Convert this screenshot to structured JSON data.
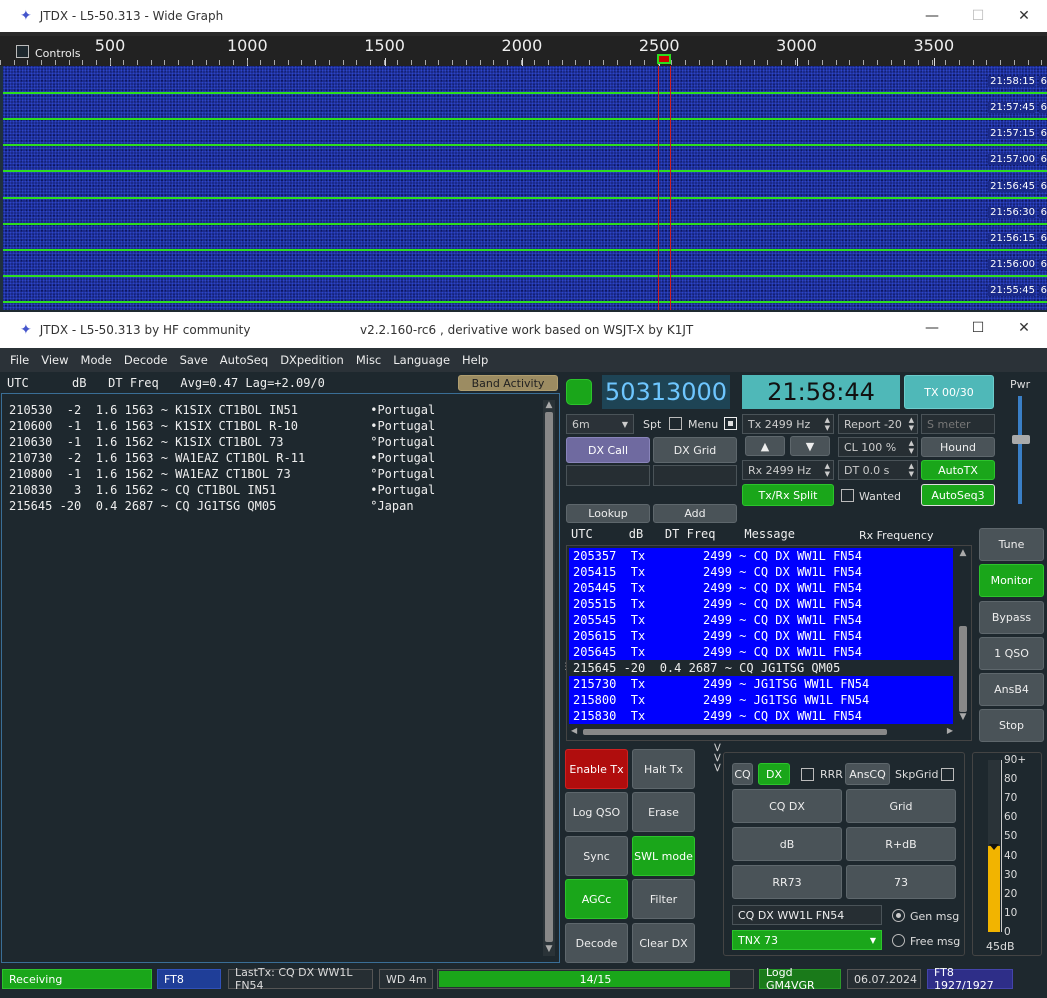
{
  "wide_graph": {
    "title": "JTDX - L5-50.313 - Wide Graph",
    "controls_label": "Controls",
    "scale_labels": [
      "500",
      "1000",
      "1500",
      "2000",
      "2500",
      "3000",
      "3500"
    ],
    "time_labels": [
      "21:58:15",
      "21:57:45",
      "21:57:15",
      "21:57:00",
      "21:56:45",
      "21:56:30",
      "21:56:15",
      "21:56:00",
      "21:55:45"
    ],
    "edge_labels": [
      "6",
      "6",
      "6",
      "6",
      "6",
      "6",
      "6",
      "6",
      "6"
    ]
  },
  "main": {
    "title": "JTDX - L5-50.313  by HF community",
    "subtitle": "v2.2.160-rc6 , derivative work based on WSJT-X by K1JT",
    "menu": [
      "File",
      "View",
      "Mode",
      "Decode",
      "Save",
      "AutoSeq",
      "DXpedition",
      "Misc",
      "Language",
      "Help"
    ],
    "band_header": "UTC      dB   DT Freq   Avg=0.47 Lag=+2.09/0",
    "band_activity_label": "Band Activity",
    "band_rows": [
      "210530  -2  1.6 1563 ~ K1SIX CT1BOL IN51          •Portugal",
      "210600  -1  1.6 1563 ~ K1SIX CT1BOL R-10          •Portugal",
      "210630  -1  1.6 1562 ~ K1SIX CT1BOL 73            °Portugal",
      "210730  -2  1.6 1563 ~ WA1EAZ CT1BOL R-11         •Portugal",
      "210800  -1  1.6 1562 ~ WA1EAZ CT1BOL 73           °Portugal",
      "210830   3  1.6 1562 ~ CQ CT1BOL IN51             •Portugal",
      "215645 -20  0.4 2687 ~ CQ JG1TSG QM05             °Japan"
    ],
    "frequency": "50313000",
    "clock": "21:58:44",
    "tx_counter": "TX 00/30",
    "pwr_label": "Pwr",
    "band": "6m",
    "spt_label": "Spt",
    "menu_label": "Menu",
    "tx_hz": "Tx  2499  Hz",
    "rx_hz": "Rx  2499  Hz",
    "report": "Report -20",
    "smeter": "S meter",
    "cl": "CL  100 %",
    "dt": "DT 0.0 s",
    "dx_call_label": "DX Call",
    "dx_grid_label": "DX Grid",
    "hound_label": "Hound",
    "autotx_label": "AutoTX",
    "autoseq_label": "AutoSeq3",
    "txrx_split_label": "Tx/Rx Split",
    "wanted_label": "Wanted",
    "lookup_label": "Lookup",
    "add_label": "Add",
    "rx_header": "UTC     dB   DT Freq    Message",
    "rx_freq_label": "Rx Frequency",
    "rx_rows": [
      {
        "t": "205357  Tx        2499 ~ CQ DX WW1L FN54",
        "tx": true
      },
      {
        "t": "205415  Tx        2499 ~ CQ DX WW1L FN54",
        "tx": true
      },
      {
        "t": "205445  Tx        2499 ~ CQ DX WW1L FN54",
        "tx": true
      },
      {
        "t": "205515  Tx        2499 ~ CQ DX WW1L FN54",
        "tx": true
      },
      {
        "t": "205545  Tx        2499 ~ CQ DX WW1L FN54",
        "tx": true
      },
      {
        "t": "205615  Tx        2499 ~ CQ DX WW1L FN54",
        "tx": true
      },
      {
        "t": "205645  Tx        2499 ~ CQ DX WW1L FN54",
        "tx": true
      },
      {
        "t": "215645 -20  0.4 2687 ~ CQ JG1TSG QM05",
        "tx": false
      },
      {
        "t": "215730  Tx        2499 ~ JG1TSG WW1L FN54",
        "tx": true
      },
      {
        "t": "215800  Tx        2499 ~ JG1TSG WW1L FN54",
        "tx": true
      },
      {
        "t": "215830  Tx        2499 ~ CQ DX WW1L FN54",
        "tx": true
      }
    ],
    "side_buttons": [
      "Tune",
      "Monitor",
      "Bypass",
      "1 QSO",
      "AnsB4",
      "Stop"
    ],
    "grid_buttons": [
      "Enable Tx",
      "Halt Tx",
      "Log QSO",
      "Erase",
      "Sync",
      "SWL mode",
      "AGCc",
      "Filter",
      "Decode",
      "Clear DX"
    ],
    "cq_label": "CQ",
    "dx_label": "DX",
    "rrr_label": "RRR",
    "anscq_label": "AnsCQ",
    "skpgrid_label": "SkpGrid",
    "msg_buttons": [
      "CQ DX",
      "Grid",
      "dB",
      "R+dB",
      "RR73",
      "73"
    ],
    "gen_msg_value": "CQ DX WW1L FN54",
    "free_msg_value": "TNX 73",
    "gen_msg_label": "Gen msg",
    "free_msg_label": "Free msg",
    "meter_labels": [
      "90+",
      "80",
      "70",
      "60",
      "50",
      "40",
      "30",
      "20",
      "10",
      "0"
    ],
    "meter_value_label": "45dB",
    "meter_level": 45,
    "status": {
      "receiving": "Receiving",
      "mode": "FT8",
      "last_tx": "LastTx: CQ DX WW1L FN54",
      "wd": "WD 4m",
      "progress": "14/15",
      "progress_fraction": 0.93,
      "logd": "Logd GM4VGR",
      "date": "06.07.2024",
      "counts": "FT8  1927/1927"
    }
  }
}
